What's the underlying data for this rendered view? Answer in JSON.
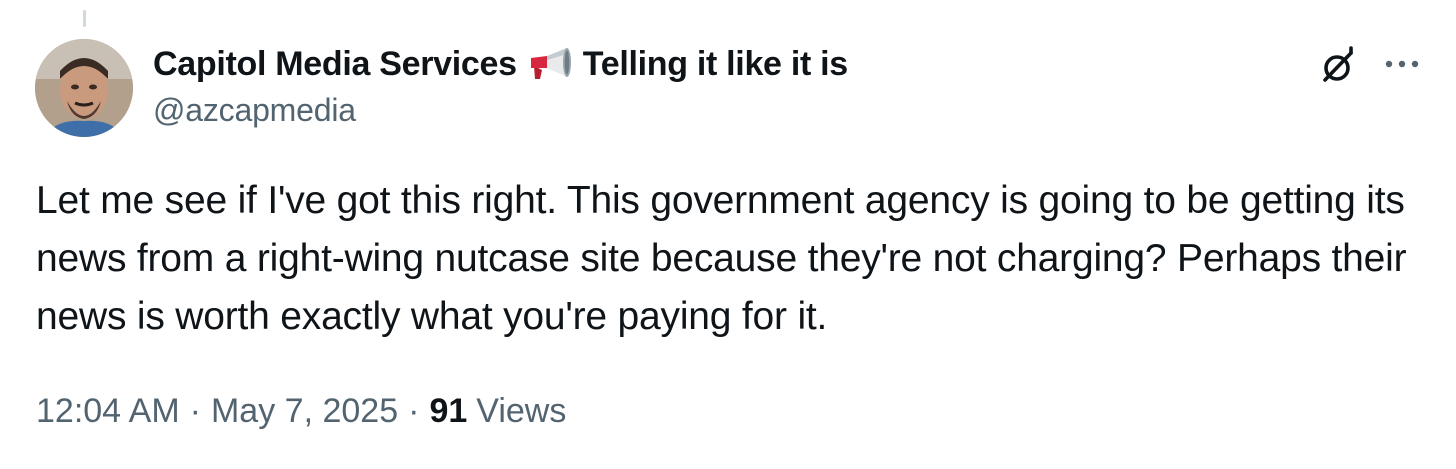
{
  "tweet": {
    "author": {
      "display_name": "Capitol Media Services",
      "name_suffix": "Telling it like it is",
      "handle": "@azcapmedia",
      "emoji_icon": "megaphone-icon"
    },
    "text": "Let me see if I've got this right. This government agency is going to be getting its news from a right-wing nutcase site because they're not charging? Perhaps their news is worth exactly what you're paying for it.",
    "time": "12:04 AM",
    "separator": "·",
    "date": "May 7, 2025",
    "views_count": "91",
    "views_label": "Views"
  },
  "icons": {
    "grok": "grok-icon",
    "more": "more-options-icon"
  },
  "colors": {
    "text_primary": "#0f1419",
    "text_secondary": "#536471",
    "thread_line": "#cfd9de",
    "megaphone_red": "#d7263d",
    "megaphone_gray": "#9aa4ab"
  }
}
